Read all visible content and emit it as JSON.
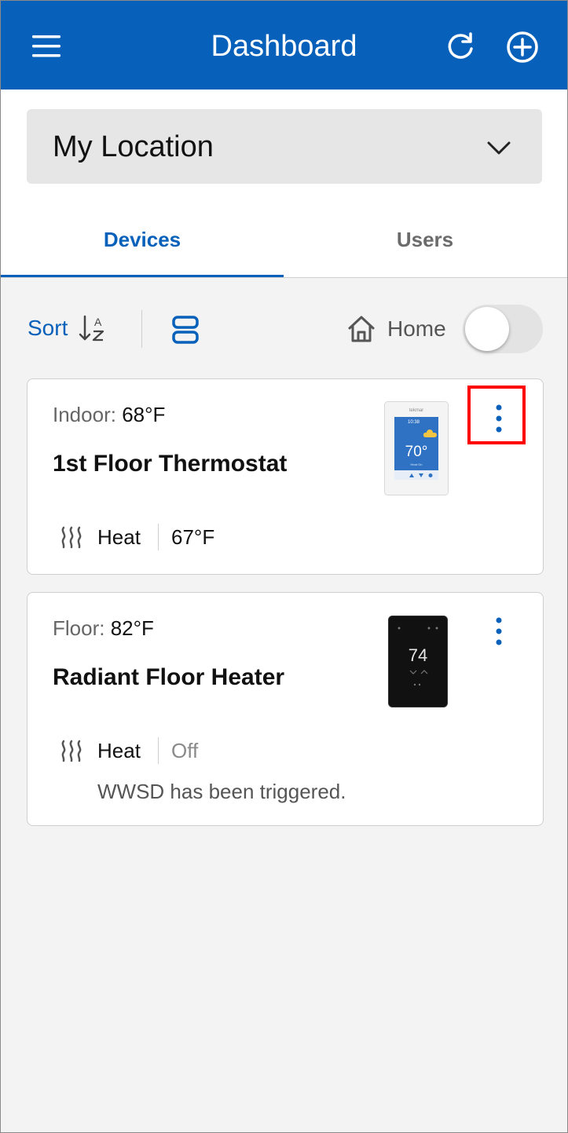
{
  "header": {
    "title": "Dashboard",
    "menu_icon": "hamburger-menu-icon",
    "refresh_icon": "refresh-icon",
    "add_icon": "add-circle-icon",
    "background_color": "#0760b9"
  },
  "location": {
    "selected": "My Location",
    "icon": "chevron-down-icon"
  },
  "tabs": [
    {
      "label": "Devices",
      "active": true
    },
    {
      "label": "Users",
      "active": false
    }
  ],
  "toolbar": {
    "sort_label": "Sort",
    "sort_icon": "sort-alpha-icon",
    "layout_icon": "list-view-icon",
    "home_icon": "home-icon",
    "home_label": "Home",
    "home_toggle_on": false
  },
  "devices": [
    {
      "reading_label": "Indoor:",
      "reading_value": "68°F",
      "name": "1st Floor Thermostat",
      "mode": "Heat",
      "setpoint": "67°F",
      "thumbnail": {
        "brand": "tekmar",
        "time": "10:38",
        "temp": "70°",
        "status": "Heat On"
      }
    },
    {
      "reading_label": "Floor:",
      "reading_value": "82°F",
      "name": "Radiant Floor Heater",
      "mode": "Heat",
      "setpoint": "Off",
      "message": "WWSD has been triggered.",
      "thumbnail": {
        "temp": "74"
      }
    }
  ],
  "colors": {
    "accent": "#0760b9",
    "highlight": "#ff0000",
    "page_background": "#f3f3f3"
  }
}
